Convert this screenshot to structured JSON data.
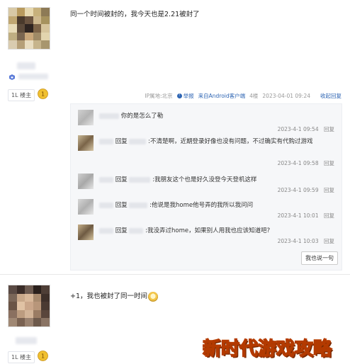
{
  "post1": {
    "floor": "1L",
    "floor_suffix": "楼主",
    "text": "同一个时间被封的，我今天也是2.21被封了",
    "meta": {
      "ip": "IP属地:北京",
      "report": "举报",
      "client": "来自Android客户端",
      "floor_num": "4楼",
      "time": "2023-04-01 09:24",
      "collapse": "收起回复"
    },
    "replies": [
      {
        "prefix": "",
        "text": "你的是怎么了勒",
        "time": "2023-4-1 09:54",
        "reply_label": "回复"
      },
      {
        "prefix": "回复",
        "text": ":不清楚啊，近期登录好像也没有问题，不过确实有代购过游戏",
        "time": "2023-4-1 09:58",
        "reply_label": "回复"
      },
      {
        "prefix": "回复",
        "text": ":我朋友这个也是好久没登今天登机这样",
        "time": "2023-4-1 09:59",
        "reply_label": "回复"
      },
      {
        "prefix": "回复",
        "text": ":他说是我home他号弄的我所以我问问",
        "time": "2023-4-1 10:01",
        "reply_label": "回复"
      },
      {
        "prefix": "回复",
        "text": ":我没弄过home，如果别人用我也应该知道吧?",
        "time": "2023-4-1 10:03",
        "reply_label": "回复"
      }
    ],
    "say_button": "我也说一句"
  },
  "post2": {
    "floor": "1L",
    "floor_suffix": "楼主",
    "text": "+1，我也被封了同一时间"
  },
  "watermark": "新时代游戏攻略",
  "colors": {
    "link": "#2d64b3",
    "level_badge": "#f0c030",
    "reply_bg": "#f6f7f9"
  }
}
